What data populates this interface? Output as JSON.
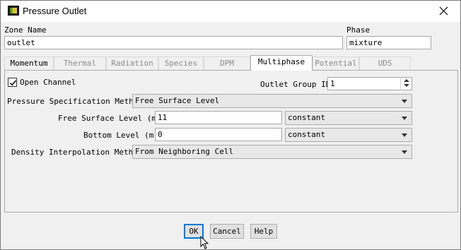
{
  "window": {
    "title": "Pressure Outlet",
    "icon": "fluent-app-icon",
    "close_icon": "close-icon"
  },
  "zone": {
    "label": "Zone Name",
    "value": "outlet"
  },
  "phase": {
    "label": "Phase",
    "value": "mixture"
  },
  "tabs": [
    {
      "label": "Momentum",
      "state": "enabled"
    },
    {
      "label": "Thermal",
      "state": "disabled"
    },
    {
      "label": "Radiation",
      "state": "disabled"
    },
    {
      "label": "Species",
      "state": "disabled"
    },
    {
      "label": "DPM",
      "state": "disabled"
    },
    {
      "label": "Multiphase",
      "state": "active"
    },
    {
      "label": "Potential",
      "state": "disabled"
    },
    {
      "label": "UDS",
      "state": "disabled"
    }
  ],
  "multiphase": {
    "open_channel": {
      "label": "Open Channel",
      "checked": true
    },
    "outlet_group": {
      "label": "Outlet Group ID",
      "value": "1"
    },
    "pressure_spec": {
      "label": "Pressure Specification Method",
      "value": "Free Surface Level"
    },
    "free_surface": {
      "label": "Free Surface Level (m)",
      "value": "11",
      "method": "constant"
    },
    "bottom_level": {
      "label": "Bottom Level (m)",
      "value": "0",
      "method": "constant"
    },
    "density_interp": {
      "label": "Density Interpolation Method",
      "value": "From Neighboring Cell"
    }
  },
  "buttons": {
    "ok": "OK",
    "cancel": "Cancel",
    "help": "Help"
  }
}
